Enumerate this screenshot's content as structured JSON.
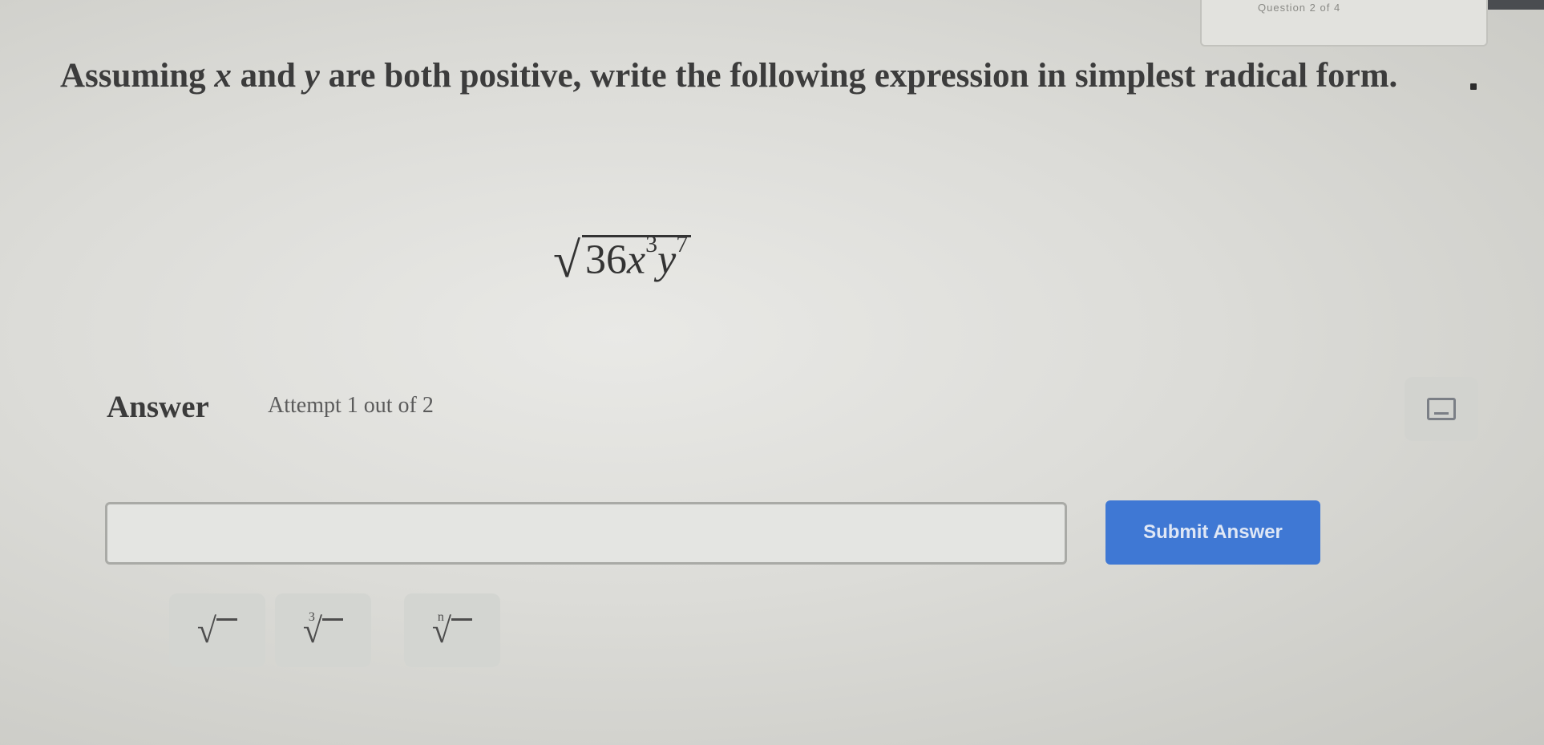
{
  "header": {
    "tab_text": "Question 2 of 4"
  },
  "question": {
    "part1": "Assuming ",
    "var_x": "x",
    "part2": " and ",
    "var_y": "y",
    "part3": " are both positive, write the following expression in simplest radical form."
  },
  "expression": {
    "radical_symbol": "√",
    "coefficient": "36",
    "var1": "x",
    "exp1": "3",
    "var2": "y",
    "exp2": "7"
  },
  "answer": {
    "label": "Answer",
    "attempt_text": "Attempt 1 out of 2",
    "input_value": "",
    "input_placeholder": "",
    "submit_label": "Submit Answer"
  },
  "math_keys": {
    "sqrt_symbol": "√",
    "cbrt_index": "3",
    "nth_index": "n"
  },
  "icons": {
    "keyboard": "keyboard-icon"
  },
  "colors": {
    "submit_button": "#3f78d4",
    "background": "#dcdcd8"
  }
}
